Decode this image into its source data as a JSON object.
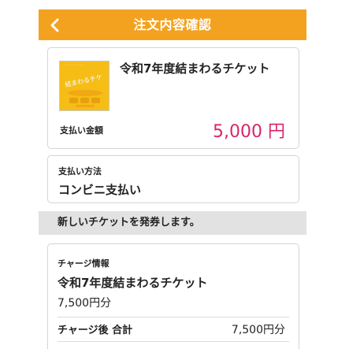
{
  "header": {
    "title": "注文内容確認",
    "back_icon": "chevron-left-icon"
  },
  "ticket": {
    "name": "令和7年度結まわるチケット",
    "image_lettering": "結まわるチケット",
    "amount_label": "支払い金額",
    "amount_value": "5,000 円"
  },
  "payment": {
    "label": "支払い方法",
    "value": "コンビニ支払い"
  },
  "notice": {
    "text": "新しいチケットを発券します。"
  },
  "charge": {
    "label": "チャージ情報",
    "ticket_name": "令和7年度結まわるチケット",
    "amount": "7,500円分",
    "total_label": "チャージ後 合計",
    "total_value": "7,500円分"
  },
  "colors": {
    "header_bg": "#f3a21f",
    "amount_text": "#d8266b",
    "notice_bg": "#e2e2e2",
    "thumbnail_bg": "#f6bd16"
  }
}
